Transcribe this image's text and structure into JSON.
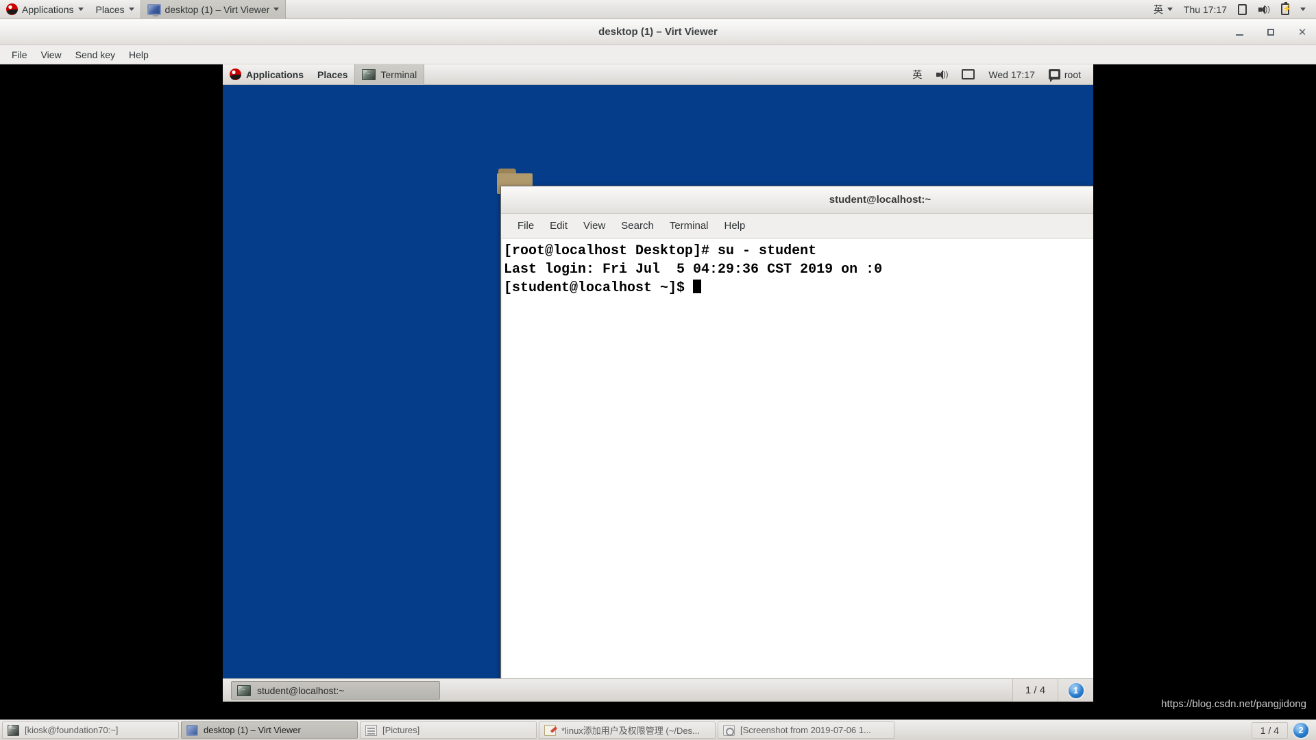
{
  "host_panel": {
    "applications_label": "Applications",
    "places_label": "Places",
    "window_item_label": "desktop (1) – Virt Viewer",
    "ime_label": "英",
    "clock_label": "Thu 17:17",
    "icons": [
      "red-hat-icon",
      "monitor-icon",
      "note-icon",
      "volume-icon",
      "battery-icon",
      "caret-down-icon"
    ]
  },
  "virt_viewer": {
    "title": "desktop (1) – Virt Viewer",
    "menus": [
      "File",
      "View",
      "Send key",
      "Help"
    ],
    "window_buttons": {
      "minimize": "–",
      "maximize": "□",
      "close": "✕"
    }
  },
  "guest": {
    "panel": {
      "applications_label": "Applications",
      "places_label": "Places",
      "window_label": "Terminal",
      "ime_label": "英",
      "clock_label": "Wed 17:17",
      "user_label": "root"
    },
    "desktop": {
      "folder_icon": "folder-icon",
      "background_color": "#063d8a"
    },
    "terminal": {
      "title": "student@localhost:~",
      "menus": [
        "File",
        "Edit",
        "View",
        "Search",
        "Terminal",
        "Help"
      ],
      "window_buttons": {
        "minimize": "-",
        "maximize": "❏",
        "close": "X"
      },
      "lines": [
        "[root@localhost Desktop]# su - student",
        "Last login: Fri Jul  5 04:29:36 CST 2019 on :0",
        "[student@localhost ~]$ "
      ]
    },
    "bottom_panel": {
      "task_label": "student@localhost:~",
      "workspace_label": "1 / 4",
      "badge_label": "1"
    }
  },
  "host_taskbar": {
    "tasks": [
      {
        "label": "[kiosk@foundation70:~]",
        "icon": "terminal-icon",
        "active": false
      },
      {
        "label": "desktop (1) – Virt Viewer",
        "icon": "monitor-icon",
        "active": true
      },
      {
        "label": "[Pictures]",
        "icon": "file-manager-icon",
        "active": false
      },
      {
        "label": "*linux添加用户及权限管理 (~/Des...",
        "icon": "text-editor-icon",
        "active": false
      },
      {
        "label": "[Screenshot from 2019-07-06 1...",
        "icon": "image-viewer-icon",
        "active": false
      }
    ],
    "workspace_label": "1 / 4",
    "badge_label": "2"
  },
  "watermark": {
    "text": "https://blog.csdn.net/pangjidong"
  }
}
